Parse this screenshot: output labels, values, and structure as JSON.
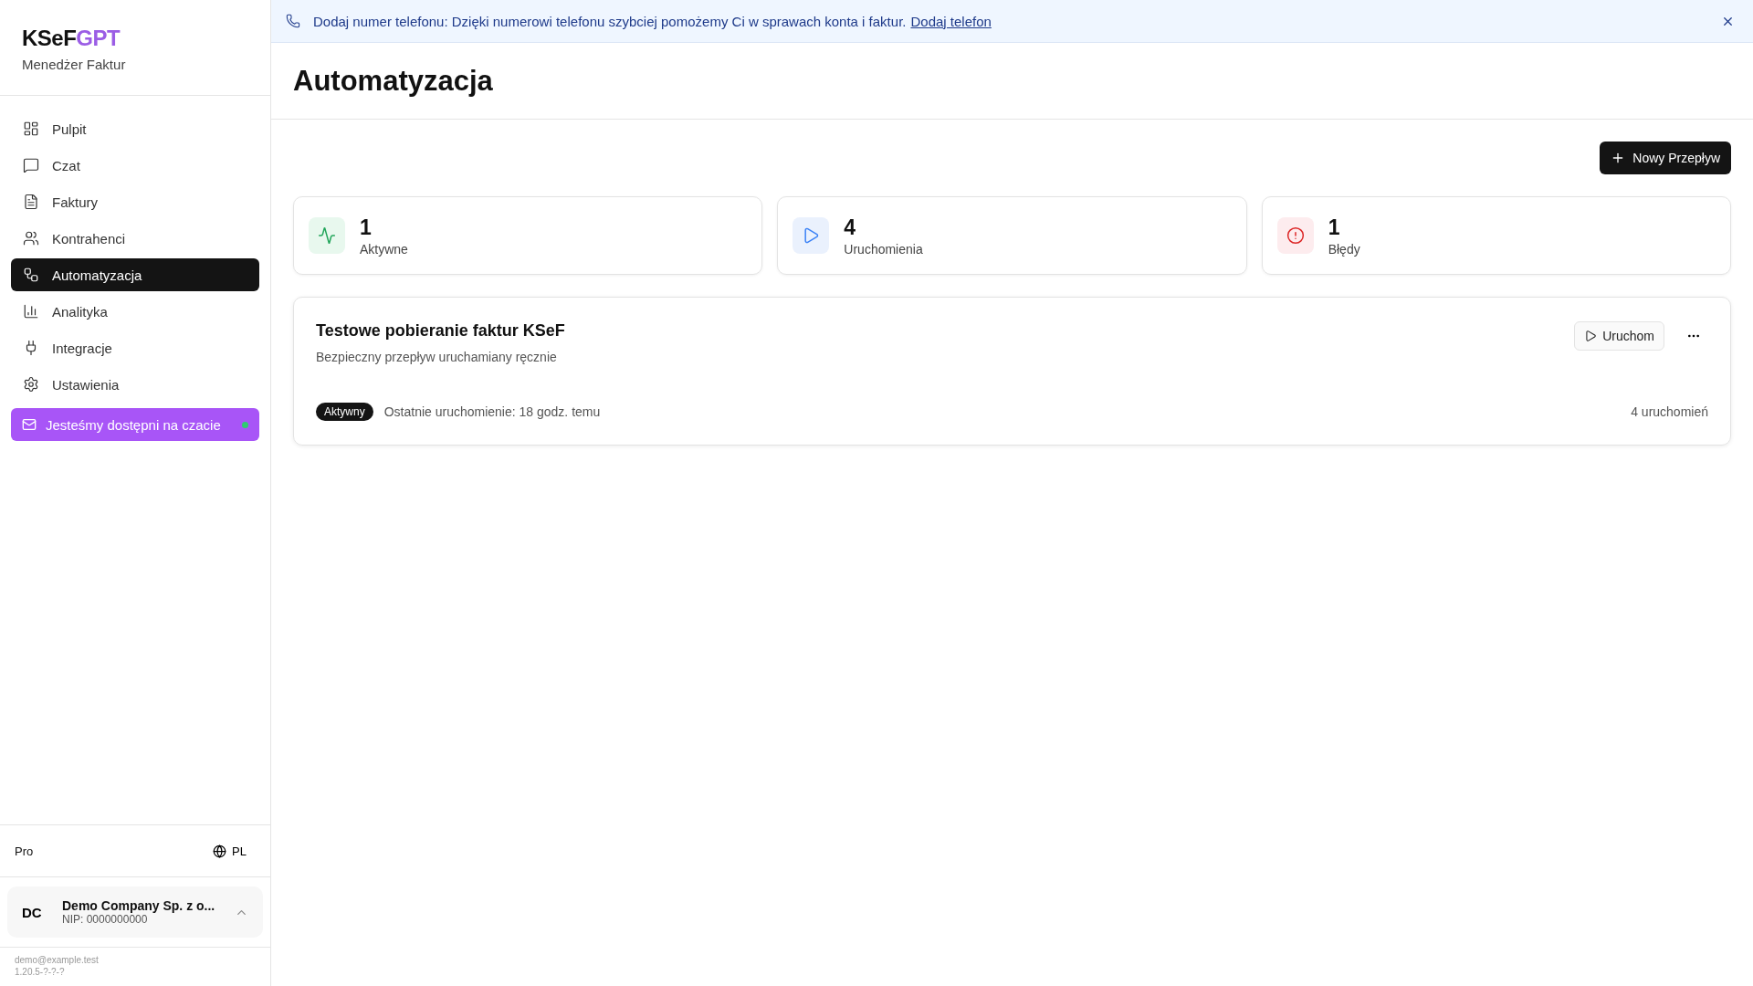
{
  "sidebar": {
    "logo": {
      "main": "KSeF",
      "accent": "GPT"
    },
    "subtitle": "Menedżer Faktur",
    "items": [
      {
        "label": "Pulpit",
        "selected": false
      },
      {
        "label": "Czat",
        "selected": false
      },
      {
        "label": "Faktury",
        "selected": false
      },
      {
        "label": "Kontrahenci",
        "selected": false
      },
      {
        "label": "Automatyzacja",
        "selected": true
      },
      {
        "label": "Analityka",
        "selected": false
      },
      {
        "label": "Integracje",
        "selected": false
      },
      {
        "label": "Ustawienia",
        "selected": false
      }
    ],
    "chat_button": {
      "label": "Jesteśmy dostępni na czacie",
      "online": true
    },
    "plan": "Pro",
    "language": "PL",
    "company": {
      "initials": "DC",
      "name": "Demo Company Sp. z o...",
      "nip": "NIP: 0000000000"
    },
    "email": "demo@example.test",
    "version": "1.20.5-?-?-?"
  },
  "banner": {
    "text": "Dodaj numer telefonu: Dzięki numerowi telefonu szybciej pomożemy Ci w sprawach konta i faktur.",
    "link": "Dodaj telefon"
  },
  "page": {
    "title": "Automatyzacja",
    "new_button": "Nowy Przepływ",
    "stats": [
      {
        "value": "1",
        "label": "Aktywne"
      },
      {
        "value": "4",
        "label": "Uruchomienia"
      },
      {
        "value": "1",
        "label": "Błędy"
      }
    ],
    "flows": [
      {
        "title": "Testowe pobieranie faktur KSeF",
        "description": "Bezpieczny przepływ uruchamiany ręcznie",
        "run_button": "Uruchom",
        "status": "Aktywny",
        "active": true,
        "last_run": "Ostatnie uruchomienie: 18 godz. temu",
        "runs": "4 uruchomień"
      }
    ]
  }
}
